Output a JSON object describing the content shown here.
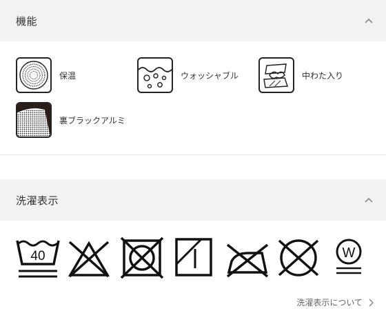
{
  "sections": {
    "features": {
      "title": "機能",
      "toggle_icon": "chevron-up-icon",
      "items": [
        {
          "label": "保温",
          "icon": "insulation-icon"
        },
        {
          "label": "ウォッシャブル",
          "icon": "washable-icon"
        },
        {
          "label": "中わた入り",
          "icon": "padding-icon"
        },
        {
          "label": "裏ブラックアルミ",
          "icon": "black-aluminum-lining-icon"
        }
      ]
    },
    "care": {
      "title": "洗濯表示",
      "toggle_icon": "chevron-up-icon",
      "symbols": [
        {
          "icon": "wash-40-icon",
          "text": "40"
        },
        {
          "icon": "no-bleach-icon"
        },
        {
          "icon": "no-tumble-dry-icon"
        },
        {
          "icon": "drip-dry-shade-icon"
        },
        {
          "icon": "no-iron-icon"
        },
        {
          "icon": "no-dry-clean-icon"
        },
        {
          "icon": "wet-clean-icon",
          "text": "W"
        }
      ],
      "link_label": "洗濯表示について",
      "link_icon": "chevron-right-icon"
    }
  }
}
